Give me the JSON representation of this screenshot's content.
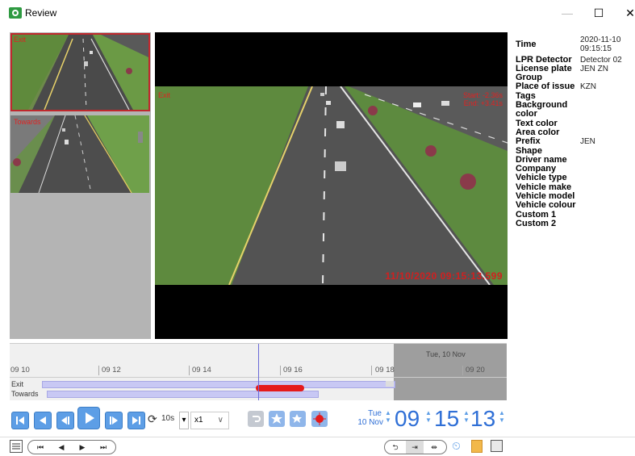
{
  "window": {
    "title": "Review",
    "min": "—",
    "max": "☐",
    "close": "✕"
  },
  "cameras": {
    "exit_label": "Exit",
    "towards_label": "Towards"
  },
  "video": {
    "camera_label": "Exit",
    "start": "Start: -2.36s",
    "end": "End: +3.41s",
    "timestamp": "11/10/2020 09:15:13.599"
  },
  "info": [
    {
      "key": "Time",
      "value": "2020-11-10\n09:15:15"
    },
    {
      "key": "LPR Detector",
      "value": "Detector 02"
    },
    {
      "key": "License plate",
      "value": "JEN ZN"
    },
    {
      "key": "Group",
      "value": ""
    },
    {
      "key": "Place of issue",
      "value": "KZN"
    },
    {
      "key": "Tags",
      "value": ""
    },
    {
      "key": "Background color",
      "value": ""
    },
    {
      "key": "Text color",
      "value": ""
    },
    {
      "key": "Area color",
      "value": ""
    },
    {
      "key": "Prefix",
      "value": "JEN"
    },
    {
      "key": "Shape",
      "value": ""
    },
    {
      "key": "Driver name",
      "value": ""
    },
    {
      "key": "Company",
      "value": ""
    },
    {
      "key": "Vehicle type",
      "value": ""
    },
    {
      "key": "Vehicle make",
      "value": ""
    },
    {
      "key": "Vehicle model",
      "value": ""
    },
    {
      "key": "Vehicle colour",
      "value": ""
    },
    {
      "key": "Custom 1",
      "value": ""
    },
    {
      "key": "Custom 2",
      "value": ""
    }
  ],
  "timeline": {
    "date": "Tue, 10 Nov",
    "ticks": [
      "09 10",
      "09 12",
      "09 14",
      "09 16",
      "09 18",
      "09 20"
    ],
    "tracks": [
      "Exit",
      "Towards"
    ]
  },
  "controls": {
    "loop_label": "10s",
    "speed": "x1",
    "day_name": "Tue",
    "day_date": "10 Nov",
    "hour": "09",
    "minute": "15",
    "second": "13"
  },
  "colors": {
    "accent": "#5d9ee6",
    "event": "#e51a1a",
    "alert": "#c0282d"
  }
}
